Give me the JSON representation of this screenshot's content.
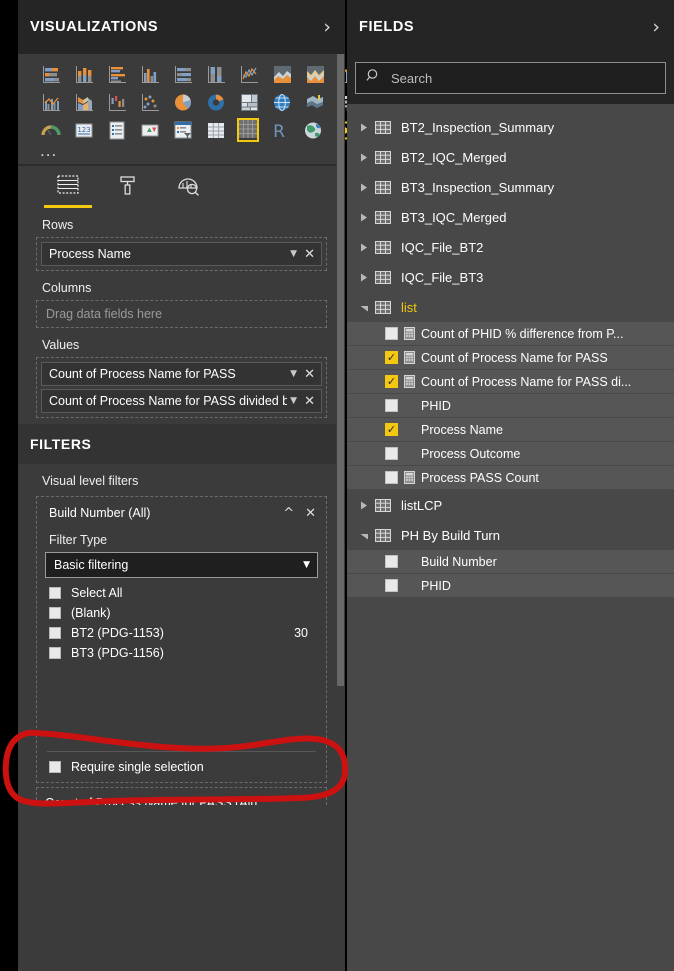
{
  "visualizations": {
    "header_title": "VISUALIZATIONS",
    "collapse_icon": "chevron-right-icon",
    "gallery_rows": [
      [
        {
          "name": "stacked-bar-chart",
          "label": "Stacked bar chart"
        },
        {
          "name": "stacked-column-chart",
          "label": "Stacked column chart"
        },
        {
          "name": "clustered-bar-chart",
          "label": "Clustered bar chart"
        },
        {
          "name": "clustered-column-chart",
          "label": "Clustered column chart"
        },
        {
          "name": "hundred-percent-stacked-bar-chart",
          "label": "100% Stacked bar chart"
        },
        {
          "name": "hundred-percent-stacked-column-chart",
          "label": "100% Stacked column chart"
        },
        {
          "name": "line-chart",
          "label": "Line chart"
        },
        {
          "name": "area-chart",
          "label": "Area chart"
        },
        {
          "name": "stacked-area-chart",
          "label": "Stacked area chart"
        },
        {
          "name": "line-and-stacked-column-chart",
          "label": "Line and stacked column chart"
        }
      ],
      [
        {
          "name": "line-and-clustered-column-chart",
          "label": "Line and clustered column chart"
        },
        {
          "name": "ribbon-chart",
          "label": "Ribbon chart"
        },
        {
          "name": "waterfall-chart",
          "label": "Waterfall chart"
        },
        {
          "name": "scatter-chart",
          "label": "Scatter chart"
        },
        {
          "name": "pie-chart",
          "label": "Pie chart"
        },
        {
          "name": "donut-chart",
          "label": "Donut chart"
        },
        {
          "name": "treemap-chart",
          "label": "Treemap"
        },
        {
          "name": "map-visual",
          "label": "Map"
        },
        {
          "name": "filled-map-visual",
          "label": "Filled map"
        },
        {
          "name": "funnel-chart",
          "label": "Funnel"
        }
      ],
      [
        {
          "name": "gauge-visual",
          "label": "Gauge"
        },
        {
          "name": "card-visual",
          "label": "Card"
        },
        {
          "name": "multi-row-card-visual",
          "label": "Multi-row card"
        },
        {
          "name": "kpi-visual",
          "label": "KPI"
        },
        {
          "name": "slicer-visual",
          "label": "Slicer"
        },
        {
          "name": "table-visual",
          "label": "Table"
        },
        {
          "name": "matrix-visual",
          "label": "Matrix"
        },
        {
          "name": "r-script-visual",
          "label": "R script visual"
        },
        {
          "name": "arcgis-maps-visual",
          "label": "ArcGIS Maps"
        },
        {
          "name": "play-axis-visual",
          "label": "Play axis"
        }
      ]
    ],
    "selected_visual": "matrix-visual",
    "more_label": "...",
    "well_tabs": [
      {
        "name": "fields-tab",
        "icon": "fields-grid-icon",
        "active": true
      },
      {
        "name": "format-tab",
        "icon": "paint-roller-icon",
        "active": false
      },
      {
        "name": "analytics-tab",
        "icon": "magnifier-chart-icon",
        "active": false
      }
    ],
    "wells": [
      {
        "label": "Rows",
        "placeholder": "",
        "chips": [
          {
            "text": "Process Name"
          }
        ]
      },
      {
        "label": "Columns",
        "placeholder": "Drag data fields here",
        "chips": []
      },
      {
        "label": "Values",
        "placeholder": "",
        "chips": [
          {
            "text": "Count of Process Name for PASS"
          },
          {
            "text": "Count of Process Name for PASS divided by C"
          }
        ]
      }
    ]
  },
  "filters": {
    "header_title": "FILTERS",
    "visual_level_label": "Visual level filters",
    "card": {
      "title": "Build Number  (All)",
      "collapse_icon": "chevron-up-icon",
      "close_icon": "close-icon",
      "filter_type_label": "Filter Type",
      "filter_type_value": "Basic filtering",
      "options": [
        {
          "label": "Select All",
          "checked": false,
          "count": ""
        },
        {
          "label": "(Blank)",
          "checked": false,
          "count": ""
        },
        {
          "label": "BT2 (PDG-1153)",
          "checked": false,
          "count": "30"
        },
        {
          "label": "BT3 (PDG-1156)",
          "checked": false,
          "count": ""
        }
      ],
      "require_single_selection_label": "Require single selection",
      "require_single_selection_checked": false
    },
    "next_card_title": "Count of Process Name for PASS (All)"
  },
  "fields": {
    "header_title": "FIELDS",
    "collapse_icon": "chevron-right-icon",
    "search_placeholder": "Search",
    "search_icon": "search-icon",
    "tree": [
      {
        "type": "table",
        "name": "BT2_Inspection_Summary",
        "expanded": false,
        "highlight": false
      },
      {
        "type": "table",
        "name": "BT2_IQC_Merged",
        "expanded": false,
        "highlight": false
      },
      {
        "type": "table",
        "name": "BT3_Inspection_Summary",
        "expanded": false,
        "highlight": false
      },
      {
        "type": "table",
        "name": "BT3_IQC_Merged",
        "expanded": false,
        "highlight": false
      },
      {
        "type": "table",
        "name": "IQC_File_BT2",
        "expanded": false,
        "highlight": false
      },
      {
        "type": "table",
        "name": "IQC_File_BT3",
        "expanded": false,
        "highlight": false
      },
      {
        "type": "table",
        "name": "list",
        "expanded": true,
        "highlight": true
      },
      {
        "type": "field",
        "name": "Count of PHID % difference from P...",
        "checked": false,
        "measure": true
      },
      {
        "type": "field",
        "name": "Count of Process Name for PASS",
        "checked": true,
        "measure": true
      },
      {
        "type": "field",
        "name": "Count of Process Name for PASS di...",
        "checked": true,
        "measure": true
      },
      {
        "type": "field",
        "name": "PHID",
        "checked": false,
        "measure": false
      },
      {
        "type": "field",
        "name": "Process Name",
        "checked": true,
        "measure": false
      },
      {
        "type": "field",
        "name": "Process Outcome",
        "checked": false,
        "measure": false
      },
      {
        "type": "field",
        "name": "Process PASS Count",
        "checked": false,
        "measure": true
      },
      {
        "type": "table",
        "name": "listLCP",
        "expanded": false,
        "highlight": false
      },
      {
        "type": "table",
        "name": "PH By Build Turn",
        "expanded": true,
        "highlight": false
      },
      {
        "type": "field",
        "name": "Build Number",
        "checked": false,
        "measure": false
      },
      {
        "type": "field",
        "name": "PHID",
        "checked": false,
        "measure": false
      }
    ]
  },
  "annotation": {
    "shape": "hand-drawn-ellipse",
    "color": "#cc1111"
  },
  "colors": {
    "accent": "#f2c811",
    "panel_bg": "#3b3b3b",
    "fields_bg": "#484848",
    "header_bg": "#252525",
    "annotation_red": "#cc1111"
  }
}
